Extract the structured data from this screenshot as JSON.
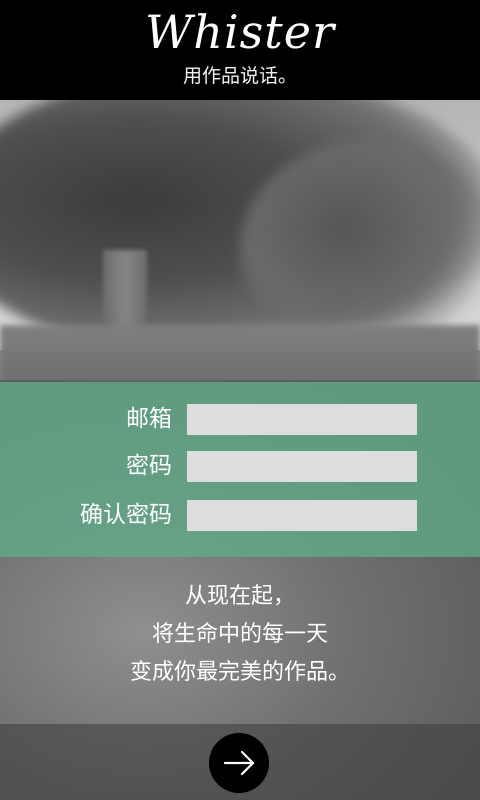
{
  "header": {
    "brand": "Whister",
    "tagline": "用作品说话。"
  },
  "form": {
    "email_label": "邮箱",
    "email_value": "",
    "password_label": "密码",
    "password_value": "",
    "confirm_label": "确认密码",
    "confirm_value": ""
  },
  "message": {
    "line1": "从现在起，",
    "line2": "将生命中的每一天",
    "line3": "变成你最完美的作品。"
  },
  "footer": {
    "next_icon": "arrow-right-icon"
  },
  "colors": {
    "form_band": "#60aa88",
    "input_bg": "#dddddd",
    "header_bg": "#000000"
  }
}
